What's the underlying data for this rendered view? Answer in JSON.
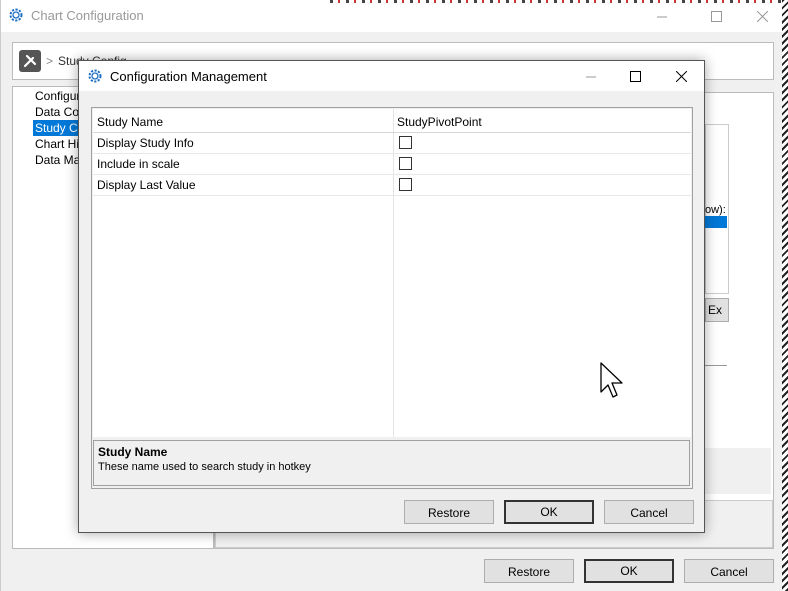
{
  "main_window": {
    "title": "Chart Configuration",
    "breadcrumb": {
      "separator": ">",
      "current": "Study Config"
    },
    "nav_items": [
      {
        "label": "Configure",
        "selected": false
      },
      {
        "label": "Data Conf",
        "selected": false
      },
      {
        "label": "Study Con",
        "selected": true
      },
      {
        "label": "Chart Histo",
        "selected": false
      },
      {
        "label": "Data Man",
        "selected": false
      }
    ],
    "ghost": {
      "ow_text": "ow):",
      "ex_button": "Ex"
    },
    "buttons": {
      "restore": "Restore",
      "ok": "OK",
      "cancel": "Cancel"
    }
  },
  "dialog": {
    "title": "Configuration Management",
    "grid": {
      "header": {
        "name": "Study Name",
        "value": "StudyPivotPoint"
      },
      "rows": [
        {
          "name": "Display Study Info",
          "checked": false
        },
        {
          "name": "Include in scale",
          "checked": false
        },
        {
          "name": "Display Last Value",
          "checked": false
        }
      ]
    },
    "help": {
      "title": "Study Name",
      "text": "These name used to search study in hotkey"
    },
    "buttons": {
      "restore": "Restore",
      "ok": "OK",
      "cancel": "Cancel"
    }
  },
  "colors": {
    "selection": "#0078d7",
    "window_bg": "#f0f0f0"
  },
  "icons": {
    "app": "gear-icon",
    "breadcrumb": "tools-icon",
    "minimize": "minimize-icon",
    "maximize": "maximize-icon",
    "close": "close-icon"
  }
}
